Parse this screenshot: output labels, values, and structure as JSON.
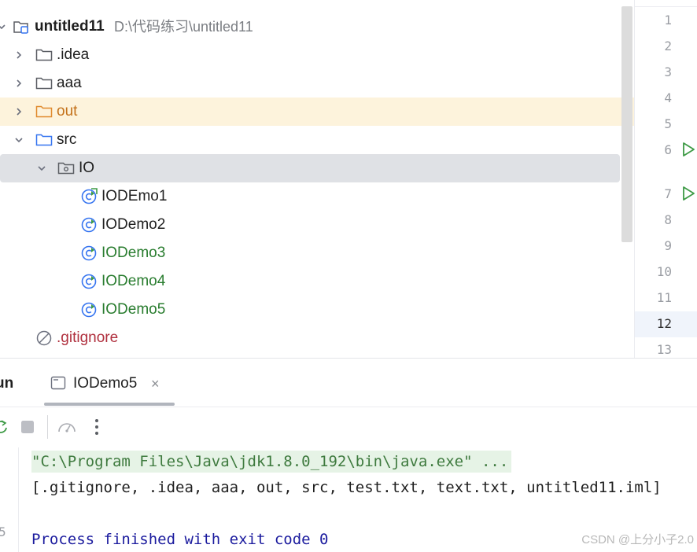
{
  "project": {
    "name": "untitled11",
    "path": "D:\\代码练习\\untitled11"
  },
  "tree": [
    {
      "label": ".idea",
      "kind": "folder"
    },
    {
      "label": "aaa",
      "kind": "folder"
    },
    {
      "label": "out",
      "kind": "folder-excluded"
    },
    {
      "label": "src",
      "kind": "folder-source"
    },
    {
      "label": "IO",
      "kind": "package"
    },
    {
      "label": "IODEmo1",
      "kind": "class"
    },
    {
      "label": "IODemo2",
      "kind": "class"
    },
    {
      "label": "IODemo3",
      "kind": "class"
    },
    {
      "label": "IODemo4",
      "kind": "class"
    },
    {
      "label": "IODemo5",
      "kind": "class"
    },
    {
      "label": ".gitignore",
      "kind": "ignored-file"
    }
  ],
  "gutter": {
    "line_numbers": [
      "1",
      "2",
      "3",
      "4",
      "5",
      "6",
      "7",
      "8",
      "9",
      "10",
      "11",
      "12",
      "13"
    ],
    "current_line": "12"
  },
  "run_panel": {
    "title": "Run",
    "title_visible": "un",
    "tab_label": "IODemo5",
    "tab_close": "×",
    "console_lines": {
      "command": "\"C:\\Program Files\\Java\\jdk1.8.0_192\\bin\\java.exe\" ...",
      "output": "[.gitignore, .idea, aaa, out, src, test.txt, text.txt, untitled11.iml]",
      "process": "Process finished with exit code 0"
    },
    "gutter_digit": "5"
  },
  "watermark": "CSDN @上分小子2.0",
  "colors": {
    "accent_green": "#287c2e",
    "excluded_orange": "#c4721b",
    "ignored_red": "#b0303e",
    "selection": "#dfe1e5",
    "highlight_out": "#fdf3dc",
    "class_icon_blue": "#3574f0"
  }
}
